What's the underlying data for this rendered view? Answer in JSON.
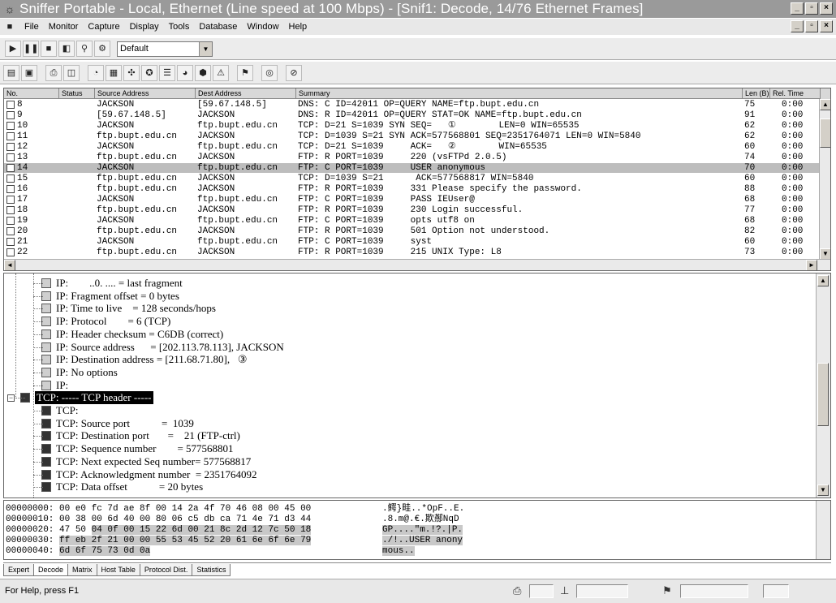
{
  "window": {
    "title": "Sniffer Portable - Local, Ethernet (Line speed at 100 Mbps) - [Snif1: Decode, 14/76 Ethernet Frames]",
    "controls": [
      "_",
      "▫",
      "×"
    ]
  },
  "menu": [
    "File",
    "Monitor",
    "Capture",
    "Display",
    "Tools",
    "Database",
    "Window",
    "Help"
  ],
  "toolbar": {
    "profile_value": "Default"
  },
  "grid": {
    "columns": [
      "No.",
      "Status",
      "Source Address",
      "Dest Address",
      "Summary",
      "Len (B)",
      "Rel. Time"
    ],
    "rows": [
      {
        "no": "8",
        "src": "JACKSON",
        "dst": "[59.67.148.5]",
        "summary": "DNS: C ID=42011 OP=QUERY NAME=ftp.bupt.edu.cn",
        "len": "75",
        "time": "0:00"
      },
      {
        "no": "9",
        "src": "[59.67.148.5]",
        "dst": "JACKSON",
        "summary": "DNS: R ID=42011 OP=QUERY STAT=OK NAME=ftp.bupt.edu.cn",
        "len": "91",
        "time": "0:00"
      },
      {
        "no": "10",
        "src": "JACKSON",
        "dst": "ftp.bupt.edu.cn",
        "summary": "TCP: D=21 S=1039 SYN SEQ=   ①        LEN=0 WIN=65535",
        "len": "62",
        "time": "0:00"
      },
      {
        "no": "11",
        "src": "ftp.bupt.edu.cn",
        "dst": "JACKSON",
        "summary": "TCP: D=1039 S=21 SYN ACK=577568801 SEQ=2351764071 LEN=0 WIN=5840",
        "len": "62",
        "time": "0:00"
      },
      {
        "no": "12",
        "src": "JACKSON",
        "dst": "ftp.bupt.edu.cn",
        "summary": "TCP: D=21 S=1039     ACK=   ②        WIN=65535",
        "len": "60",
        "time": "0:00"
      },
      {
        "no": "13",
        "src": "ftp.bupt.edu.cn",
        "dst": "JACKSON",
        "summary": "FTP: R PORT=1039     220 (vsFTPd 2.0.5)",
        "len": "74",
        "time": "0:00"
      },
      {
        "no": "14",
        "src": "JACKSON",
        "dst": "ftp.bupt.edu.cn",
        "summary": "FTP: C PORT=1039     USER anonymous",
        "len": "70",
        "time": "0:00",
        "selected": true
      },
      {
        "no": "15",
        "src": "ftp.bupt.edu.cn",
        "dst": "JACKSON",
        "summary": "TCP: D=1039 S=21      ACK=577568817 WIN=5840",
        "len": "60",
        "time": "0:00"
      },
      {
        "no": "16",
        "src": "ftp.bupt.edu.cn",
        "dst": "JACKSON",
        "summary": "FTP: R PORT=1039     331 Please specify the password.",
        "len": "88",
        "time": "0:00"
      },
      {
        "no": "17",
        "src": "JACKSON",
        "dst": "ftp.bupt.edu.cn",
        "summary": "FTP: C PORT=1039     PASS IEUser@",
        "len": "68",
        "time": "0:00"
      },
      {
        "no": "18",
        "src": "ftp.bupt.edu.cn",
        "dst": "JACKSON",
        "summary": "FTP: R PORT=1039     230 Login successful.",
        "len": "77",
        "time": "0:00"
      },
      {
        "no": "19",
        "src": "JACKSON",
        "dst": "ftp.bupt.edu.cn",
        "summary": "FTP: C PORT=1039     opts utf8 on",
        "len": "68",
        "time": "0:00"
      },
      {
        "no": "20",
        "src": "ftp.bupt.edu.cn",
        "dst": "JACKSON",
        "summary": "FTP: R PORT=1039     501 Option not understood.",
        "len": "82",
        "time": "0:00"
      },
      {
        "no": "21",
        "src": "JACKSON",
        "dst": "ftp.bupt.edu.cn",
        "summary": "FTP: C PORT=1039     syst",
        "len": "60",
        "time": "0:00"
      },
      {
        "no": "22",
        "src": "ftp.bupt.edu.cn",
        "dst": "JACKSON",
        "summary": "FTP: R PORT=1039     215 UNIX Type: L8",
        "len": "73",
        "time": "0:00"
      }
    ]
  },
  "detail": {
    "lines": [
      {
        "text": "IP:        ..0. .... = last fragment",
        "icon": "light"
      },
      {
        "text": "IP: Fragment offset = 0 bytes",
        "icon": "light"
      },
      {
        "text": "IP: Time to live    = 128 seconds/hops",
        "icon": "light"
      },
      {
        "text": "IP: Protocol        = 6 (TCP)",
        "icon": "light"
      },
      {
        "text": "IP: Header checksum = C6DB (correct)",
        "icon": "light"
      },
      {
        "text": "IP: Source address      = [202.113.78.113], JACKSON",
        "icon": "light"
      },
      {
        "text": "IP: Destination address = [211.68.71.80],   ③",
        "icon": "light"
      },
      {
        "text": "IP: No options",
        "icon": "light"
      },
      {
        "text": "IP:",
        "icon": "light"
      },
      {
        "text": "TCP: ----- TCP header -----",
        "icon": "header"
      },
      {
        "text": "TCP:",
        "icon": "dark"
      },
      {
        "text": "TCP: Source port            =  1039",
        "icon": "dark"
      },
      {
        "text": "TCP: Destination port       =    21 (FTP-ctrl)",
        "icon": "dark"
      },
      {
        "text": "TCP: Sequence number        = 577568801",
        "icon": "dark"
      },
      {
        "text": "TCP: Next expected Seq number= 577568817",
        "icon": "dark"
      },
      {
        "text": "TCP: Acknowledgment number  = 2351764092",
        "icon": "dark"
      },
      {
        "text": "TCP: Data offset            = 20 bytes",
        "icon": "dark"
      }
    ]
  },
  "hex": {
    "rows": [
      {
        "addr": "00000000:",
        "pre": "00 e0 fc 7d ae 8f 00 14 2a 4f 70 46 08 00 45 00",
        "sel": "",
        "ascii": ".鳄}畦..*OpF..E."
      },
      {
        "addr": "00000010:",
        "pre": "00 38 00 6d 40 00 80 06 c5 db ca 71 4e 71 d3 44",
        "sel": "",
        "ascii": ".8.m@.€.欺酀NqD"
      },
      {
        "addr": "00000020:",
        "pre": "47 50 ",
        "sel": "04 0f 00 15 22 6d 00 21 8c 2d 12 7c 50 18",
        "ascii": "GP....\"m.!?.|P."
      },
      {
        "addr": "00000030:",
        "pre": "",
        "sel": "ff eb 2f 21 00 00 55 53 45 52 20 61 6e 6f 6e 79",
        "ascii": "./!..USER anony"
      },
      {
        "addr": "00000040:",
        "pre": "",
        "sel": "6d 6f 75 73 0d 0a",
        "ascii": "mous.."
      }
    ]
  },
  "tabs": [
    "Expert",
    "Decode",
    "Matrix",
    "Host Table",
    "Protocol Dist.",
    "Statistics"
  ],
  "active_tab": "Decode",
  "status": {
    "help_text": "For Help, press F1"
  }
}
